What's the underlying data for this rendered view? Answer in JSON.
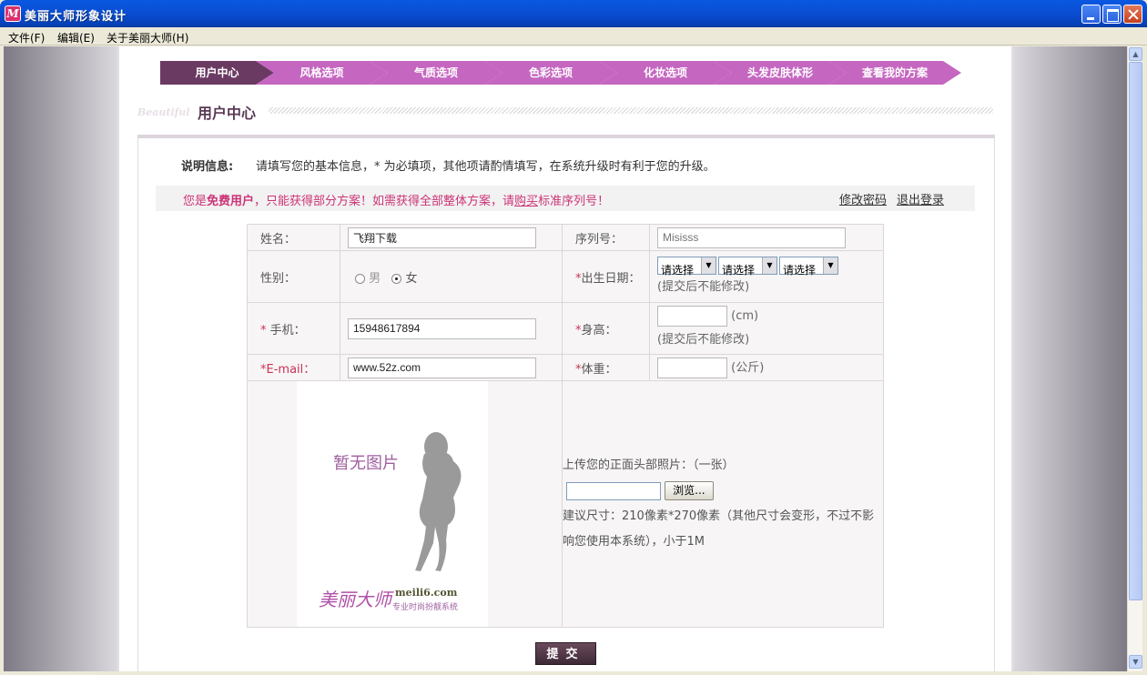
{
  "window": {
    "title": "美丽大师形象设计",
    "app_icon_letter": "M"
  },
  "menubar": {
    "items": [
      "文件(F)",
      "编辑(E)",
      "关于美丽大师(H)"
    ]
  },
  "steps": [
    "用户中心",
    "风格选项",
    "气质选项",
    "色彩选项",
    "化妆选项",
    "头发皮肤体形",
    "查看我的方案"
  ],
  "heading": {
    "decor": "Beautiful",
    "title": "用户中心"
  },
  "info": {
    "label": "说明信息:",
    "text": "请填写您的基本信息，* 为必填项，其他项请酌情填写，在系统升级时有利于您的升级。"
  },
  "notice": {
    "prefix": "您是",
    "bold": "免费用户",
    "middle": "，只能获得部分方案！如需获得全部整体方案，请",
    "link": "购买",
    "suffix": "标准序列号！",
    "change_password": "修改密码",
    "logout": "退出登录"
  },
  "form": {
    "name_label": "姓名：",
    "name_value": "飞翔下载",
    "serial_label": "序列号：",
    "serial_placeholder": "Misisss",
    "gender_label": "性别：",
    "gender_male": "男",
    "gender_female": "女",
    "gender_selected": "女",
    "birth_label": "出生日期：",
    "birth_selects": [
      "请选择",
      "请选择",
      "请选择"
    ],
    "birth_note": "(提交后不能修改)",
    "phone_label": "手机：",
    "phone_value": "15948617894",
    "height_label": "身高：",
    "height_unit": "(cm)",
    "height_note": "(提交后不能修改)",
    "email_label": "E-mail：",
    "email_value": "www.52z.com",
    "weight_label": "体重：",
    "weight_unit": "(公斤)"
  },
  "photo": {
    "no_image": "暂无图片",
    "brand": "美丽大师",
    "brand_url": "meili6.com",
    "brand_sub": "专业时尚扮靓系统"
  },
  "upload": {
    "title": "上传您的正面头部照片：（一张）",
    "browse": "浏览...",
    "hint": "建议尺寸：210像素*270像素（其他尺寸会变形，不过不影响您使用本系统），小于1M"
  },
  "submit": "提交",
  "colors": {
    "accent": "#c567c0",
    "active_step": "#6b3a63",
    "notice": "#cc3377"
  }
}
